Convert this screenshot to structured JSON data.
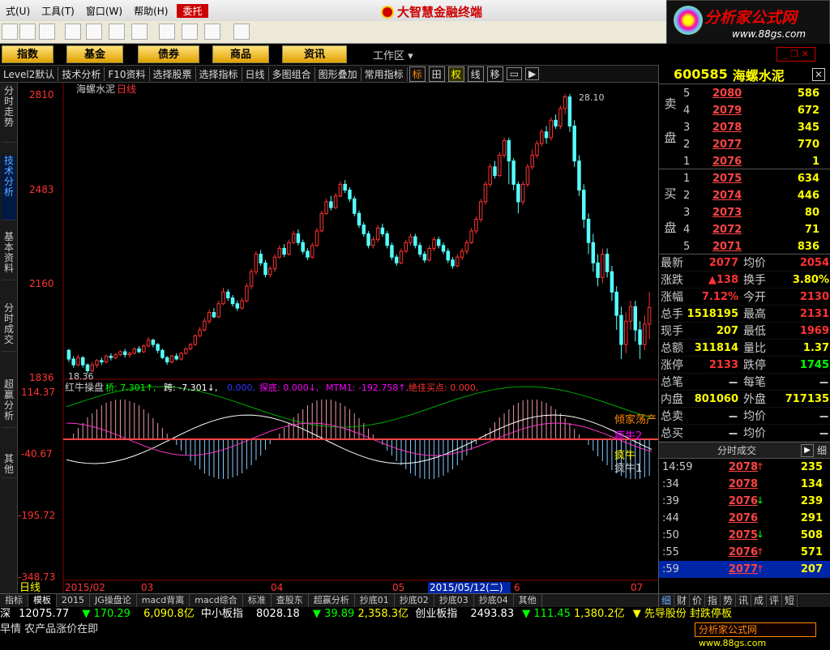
{
  "menu": {
    "items": [
      "式(U)",
      "工具(T)",
      "窗口(W)",
      "帮助(H)"
    ],
    "weituo": "委托"
  },
  "app": {
    "title": "大智慧金融终端"
  },
  "logo": {
    "cn": "分析家公式网",
    "url": "www.88gs.com"
  },
  "nav": {
    "buttons": [
      "指数",
      "基金",
      "债券",
      "商品",
      "资讯"
    ],
    "workzone": "工作区",
    "winctrl": "_ ❐ ✕"
  },
  "controls": [
    "Level2默认",
    "技术分析",
    "F10资料",
    "选择股票",
    "选择指标",
    "日线",
    "多图组合",
    "图形叠加",
    "常用指标",
    "标",
    "田",
    "权",
    "线",
    "移"
  ],
  "vtabs": [
    "分时走势",
    "技术分析",
    "基本资料",
    "分时成交",
    "超赢分析",
    "其他"
  ],
  "stock": {
    "code": "600585",
    "name": "海螺水泥",
    "period": "日线"
  },
  "price_axis": [
    "2810",
    "2483",
    "2160",
    "1836"
  ],
  "indicator_axis": [
    "114.37",
    "-40.67",
    "-195.72",
    "-348.73"
  ],
  "price_labels": {
    "high": "2810",
    "low": "18.36",
    "top_tag": "28.10"
  },
  "indicator": {
    "name": "红牛操盘",
    "v1": "桥: 7.301↑,",
    "v2": "跨: -7.301↓,",
    "v3": "0.000,",
    "v4": "探底: 0.000↓,",
    "v5": "MTM1: -192.758↑,",
    "v6": "绝佳买点: 0.000,"
  },
  "annotations": {
    "a1": "倾家荡产",
    "a2": "疯牛2",
    "a3": "疯牛",
    "a4": "疯牛1"
  },
  "date_axis": {
    "period": "日线",
    "labels": [
      "2015/02",
      "03",
      "04",
      "05",
      "2015/05/12(二)",
      "6",
      "07"
    ]
  },
  "bottom_tabs": [
    "指标",
    "模板",
    "2015",
    "JG操盘论",
    "macd背离",
    "macd综合",
    "标准",
    "查股东",
    "超赢分析",
    "抄底01",
    "抄底02",
    "抄底03",
    "抄底04",
    "其他"
  ],
  "ticker1": {
    "a": "深",
    "b": "12075.77",
    "c": "▼ 170.29",
    "d": "6,090.8亿",
    "e": "中小板指",
    "f": "8028.18",
    "g": "▼ 39.89",
    "h": "2,358.3亿",
    "i": "创业板指",
    "j": "2493.83",
    "k": "▼ 111.45",
    "l": "1,380.2亿",
    "m": "▼ 先导股份 封跌停板"
  },
  "ticker2": {
    "text": "早情 农产品涨价在即"
  },
  "orderbook": {
    "sell_label": [
      "卖",
      "盘"
    ],
    "buy_label": [
      "买",
      "盘"
    ],
    "sell": [
      {
        "n": "5",
        "p": "2080",
        "v": "586"
      },
      {
        "n": "4",
        "p": "2079",
        "v": "672"
      },
      {
        "n": "3",
        "p": "2078",
        "v": "345"
      },
      {
        "n": "2",
        "p": "2077",
        "v": "770"
      },
      {
        "n": "1",
        "p": "2076",
        "v": "1"
      }
    ],
    "buy": [
      {
        "n": "1",
        "p": "2075",
        "v": "634"
      },
      {
        "n": "2",
        "p": "2074",
        "v": "446"
      },
      {
        "n": "3",
        "p": "2073",
        "v": "80"
      },
      {
        "n": "4",
        "p": "2072",
        "v": "71"
      },
      {
        "n": "5",
        "p": "2071",
        "v": "836"
      }
    ]
  },
  "stats": [
    {
      "l": "最新",
      "v": "2077",
      "c": "red",
      "l2": "均价",
      "v2": "2054",
      "c2": "red"
    },
    {
      "l": "涨跌",
      "v": "▲138",
      "c": "red",
      "l2": "换手",
      "v2": "3.80%",
      "c2": "yel"
    },
    {
      "l": "涨幅",
      "v": "7.12%",
      "c": "red",
      "l2": "今开",
      "v2": "2130",
      "c2": "red"
    },
    {
      "l": "总手",
      "v": "1518195",
      "c": "yel",
      "l2": "最高",
      "v2": "2131",
      "c2": "red"
    },
    {
      "l": "现手",
      "v": "207",
      "c": "yel",
      "l2": "最低",
      "v2": "1969",
      "c2": "red"
    },
    {
      "l": "总额",
      "v": "311814",
      "c": "yel",
      "l2": "量比",
      "v2": "1.37",
      "c2": "yel"
    },
    {
      "l": "涨停",
      "v": "2133",
      "c": "red",
      "l2": "跌停",
      "v2": "1745",
      "c2": "grn"
    },
    {
      "l": "总笔",
      "v": "－",
      "c": "wht",
      "l2": "每笔",
      "v2": "－",
      "c2": "wht"
    },
    {
      "l": "内盘",
      "v": "801060",
      "c": "yel",
      "l2": "外盘",
      "v2": "717135",
      "c2": "yel"
    },
    {
      "l": "总卖",
      "v": "－",
      "c": "wht",
      "l2": "均价",
      "v2": "－",
      "c2": "wht"
    },
    {
      "l": "总买",
      "v": "－",
      "c": "wht",
      "l2": "均价",
      "v2": "－",
      "c2": "wht"
    }
  ],
  "trades_head": {
    "title": "分时成交",
    "detail": "细"
  },
  "trades": [
    {
      "t": "14:59",
      "p": "2078",
      "d": "up",
      "v": "235"
    },
    {
      "t": ":34",
      "p": "2078",
      "d": "",
      "v": "134"
    },
    {
      "t": ":39",
      "p": "2076",
      "d": "down",
      "v": "239"
    },
    {
      "t": ":44",
      "p": "2076",
      "d": "",
      "v": "291"
    },
    {
      "t": ":50",
      "p": "2075",
      "d": "down",
      "v": "508"
    },
    {
      "t": ":55",
      "p": "2076",
      "d": "up",
      "v": "571"
    },
    {
      "t": ":59",
      "p": "2077",
      "d": "up",
      "v": "207"
    }
  ],
  "panel_tabs": [
    "细",
    "财",
    "价",
    "指",
    "势",
    "讯",
    "成",
    "评",
    "短"
  ],
  "chart_data": {
    "type": "candlestick",
    "title": "海螺水泥日线",
    "ylim": [
      1836,
      2810
    ],
    "candles": [
      [
        1930,
        1900,
        1935,
        1890
      ],
      [
        1900,
        1880,
        1910,
        1870
      ],
      [
        1880,
        1905,
        1915,
        1875
      ],
      [
        1905,
        1880,
        1910,
        1870
      ],
      [
        1880,
        1860,
        1885,
        1850
      ],
      [
        1860,
        1880,
        1890,
        1855
      ],
      [
        1880,
        1895,
        1900,
        1870
      ],
      [
        1895,
        1890,
        1905,
        1880
      ],
      [
        1890,
        1910,
        1915,
        1885
      ],
      [
        1910,
        1905,
        1920,
        1895
      ],
      [
        1905,
        1915,
        1920,
        1900
      ],
      [
        1915,
        1925,
        1930,
        1910
      ],
      [
        1925,
        1915,
        1935,
        1905
      ],
      [
        1915,
        1920,
        1925,
        1905
      ],
      [
        1920,
        1935,
        1940,
        1915
      ],
      [
        1935,
        1925,
        1945,
        1920
      ],
      [
        1925,
        1945,
        1950,
        1920
      ],
      [
        1945,
        1965,
        1975,
        1940
      ],
      [
        1965,
        1950,
        1970,
        1940
      ],
      [
        1950,
        1930,
        1955,
        1920
      ],
      [
        1930,
        1905,
        1935,
        1900
      ],
      [
        1905,
        1890,
        1910,
        1880
      ],
      [
        1890,
        1910,
        1915,
        1885
      ],
      [
        1910,
        1900,
        1920,
        1895
      ],
      [
        1900,
        1920,
        1925,
        1895
      ],
      [
        1920,
        1935,
        1940,
        1915
      ],
      [
        1935,
        1950,
        1955,
        1930
      ],
      [
        1950,
        1980,
        1985,
        1945
      ],
      [
        1980,
        2000,
        2010,
        1975
      ],
      [
        2000,
        2030,
        2040,
        1995
      ],
      [
        2030,
        2060,
        2070,
        2020
      ],
      [
        2060,
        2045,
        2075,
        2040
      ],
      [
        2045,
        2090,
        2100,
        2040
      ],
      [
        2090,
        2130,
        2145,
        2085
      ],
      [
        2130,
        2110,
        2140,
        2100
      ],
      [
        2110,
        2090,
        2120,
        2080
      ],
      [
        2090,
        2075,
        2100,
        2065
      ],
      [
        2075,
        2100,
        2110,
        2070
      ],
      [
        2100,
        2150,
        2160,
        2095
      ],
      [
        2150,
        2200,
        2210,
        2140
      ],
      [
        2200,
        2260,
        2270,
        2190
      ],
      [
        2260,
        2230,
        2275,
        2220
      ],
      [
        2230,
        2190,
        2240,
        2180
      ],
      [
        2190,
        2210,
        2220,
        2180
      ],
      [
        2210,
        2250,
        2260,
        2200
      ],
      [
        2250,
        2280,
        2290,
        2245
      ],
      [
        2280,
        2260,
        2295,
        2250
      ],
      [
        2260,
        2300,
        2310,
        2255
      ],
      [
        2300,
        2330,
        2340,
        2295
      ],
      [
        2330,
        2300,
        2345,
        2290
      ],
      [
        2300,
        2270,
        2310,
        2260
      ],
      [
        2270,
        2250,
        2280,
        2240
      ],
      [
        2250,
        2290,
        2300,
        2245
      ],
      [
        2290,
        2340,
        2350,
        2285
      ],
      [
        2340,
        2400,
        2410,
        2335
      ],
      [
        2400,
        2440,
        2450,
        2395
      ],
      [
        2440,
        2420,
        2460,
        2410
      ],
      [
        2420,
        2460,
        2470,
        2415
      ],
      [
        2460,
        2500,
        2510,
        2455
      ],
      [
        2500,
        2480,
        2515,
        2470
      ],
      [
        2480,
        2450,
        2490,
        2440
      ],
      [
        2450,
        2400,
        2460,
        2390
      ],
      [
        2400,
        2360,
        2410,
        2350
      ],
      [
        2360,
        2330,
        2370,
        2320
      ],
      [
        2330,
        2290,
        2340,
        2280
      ],
      [
        2290,
        2310,
        2320,
        2280
      ],
      [
        2310,
        2350,
        2360,
        2300
      ],
      [
        2350,
        2330,
        2365,
        2320
      ],
      [
        2330,
        2290,
        2340,
        2280
      ],
      [
        2290,
        2250,
        2300,
        2240
      ],
      [
        2250,
        2230,
        2260,
        2220
      ],
      [
        2230,
        2270,
        2280,
        2225
      ],
      [
        2270,
        2300,
        2310,
        2265
      ],
      [
        2300,
        2320,
        2330,
        2290
      ],
      [
        2320,
        2290,
        2330,
        2280
      ],
      [
        2290,
        2260,
        2300,
        2250
      ],
      [
        2260,
        2240,
        2270,
        2230
      ],
      [
        2240,
        2280,
        2290,
        2235
      ],
      [
        2280,
        2310,
        2320,
        2270
      ],
      [
        2310,
        2290,
        2320,
        2280
      ],
      [
        2290,
        2270,
        2300,
        2260
      ],
      [
        2270,
        2240,
        2280,
        2230
      ],
      [
        2240,
        2220,
        2250,
        2210
      ],
      [
        2220,
        2250,
        2260,
        2215
      ],
      [
        2250,
        2270,
        2280,
        2240
      ],
      [
        2270,
        2300,
        2310,
        2260
      ],
      [
        2300,
        2340,
        2350,
        2295
      ],
      [
        2340,
        2380,
        2390,
        2330
      ],
      [
        2380,
        2440,
        2450,
        2370
      ],
      [
        2440,
        2500,
        2510,
        2430
      ],
      [
        2500,
        2560,
        2570,
        2490
      ],
      [
        2560,
        2530,
        2580,
        2520
      ],
      [
        2530,
        2600,
        2610,
        2525
      ],
      [
        2600,
        2650,
        2660,
        2590
      ],
      [
        2650,
        2580,
        2660,
        2500
      ],
      [
        2580,
        2500,
        2590,
        2480
      ],
      [
        2500,
        2440,
        2510,
        2400
      ],
      [
        2440,
        2500,
        2510,
        2430
      ],
      [
        2500,
        2560,
        2570,
        2490
      ],
      [
        2560,
        2600,
        2620,
        2550
      ],
      [
        2600,
        2640,
        2650,
        2590
      ],
      [
        2640,
        2680,
        2690,
        2630
      ],
      [
        2680,
        2660,
        2700,
        2640
      ],
      [
        2660,
        2720,
        2730,
        2650
      ],
      [
        2720,
        2700,
        2740,
        2690
      ],
      [
        2700,
        2760,
        2770,
        2690
      ],
      [
        2760,
        2800,
        2810,
        2740
      ],
      [
        2800,
        2700,
        2810,
        2680
      ],
      [
        2700,
        2580,
        2720,
        2560
      ],
      [
        2580,
        2480,
        2600,
        2460
      ],
      [
        2480,
        2380,
        2500,
        2350
      ],
      [
        2380,
        2300,
        2400,
        2260
      ],
      [
        2300,
        2230,
        2330,
        2200
      ],
      [
        2230,
        2180,
        2260,
        2150
      ],
      [
        2180,
        2260,
        2280,
        2160
      ],
      [
        2260,
        2200,
        2280,
        2180
      ],
      [
        2200,
        2130,
        2220,
        2100
      ],
      [
        2130,
        2050,
        2150,
        2000
      ],
      [
        2050,
        1950,
        2080,
        1900
      ],
      [
        1950,
        2030,
        2060,
        1920
      ],
      [
        2030,
        2080,
        2100,
        2000
      ],
      [
        2080,
        2000,
        2100,
        1960
      ],
      [
        2000,
        1950,
        2030,
        1900
      ],
      [
        1950,
        2020,
        2050,
        1930
      ],
      [
        2020,
        2077,
        2131,
        1969
      ]
    ]
  }
}
